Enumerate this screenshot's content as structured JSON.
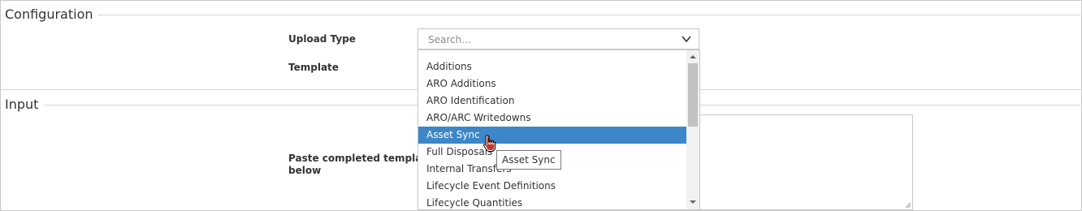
{
  "configuration": {
    "title": "Configuration",
    "upload_type_label": "Upload Type",
    "template_label": "Template",
    "search_placeholder": "Search..."
  },
  "input": {
    "title": "Input",
    "paste_label_line1": "Paste completed template",
    "paste_label_line2": "below"
  },
  "dropdown": {
    "options": [
      {
        "label": "Additions"
      },
      {
        "label": "ARO Additions"
      },
      {
        "label": "ARO Identification"
      },
      {
        "label": "ARO/ARC Writedowns"
      },
      {
        "label": "Asset Sync"
      },
      {
        "label": "Full Disposals"
      },
      {
        "label": "Internal Transfers"
      },
      {
        "label": "Lifecycle Event Definitions"
      },
      {
        "label": "Lifecycle Quantities"
      }
    ],
    "selected_label": "Asset Sync"
  },
  "tooltip": {
    "text": "Asset Sync"
  },
  "icons": {
    "dropdown_toggle": "chevron-down-icon",
    "scroll_up": "caret-up-icon",
    "scroll_down": "caret-down-icon",
    "cursor": "hand-pointer-icon",
    "resize": "resize-grip-icon"
  },
  "colors": {
    "selected_bg": "#3d87c8",
    "template_accent": "#1e4f8a"
  }
}
